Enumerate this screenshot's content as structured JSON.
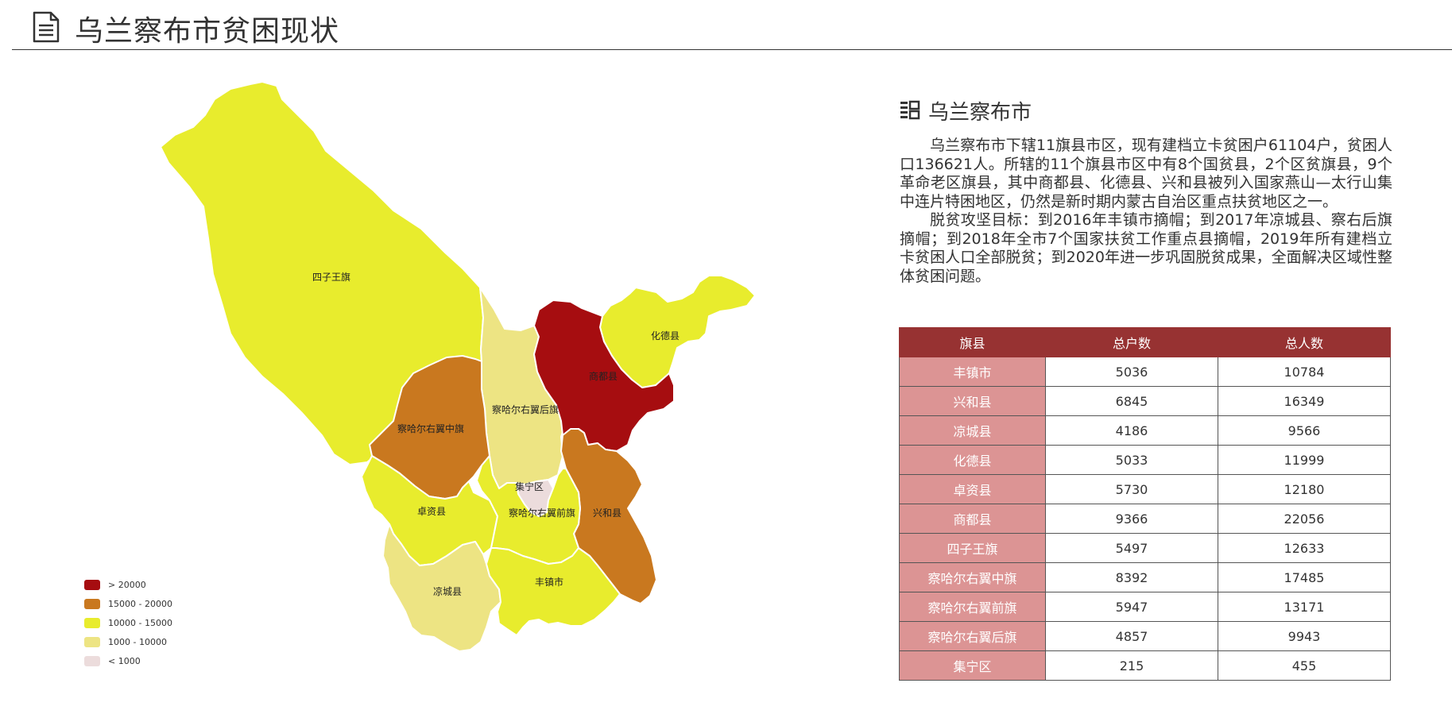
{
  "header": {
    "title": "乌兰察布市贫困现状",
    "icon": "document-icon"
  },
  "map": {
    "regions": [
      {
        "name": "四子王旗",
        "value": 12633,
        "color": "#e8ec2d"
      },
      {
        "name": "化德县",
        "value": 11999,
        "color": "#e8ec2d"
      },
      {
        "name": "商都县",
        "value": 22056,
        "color": "#a60d10"
      },
      {
        "name": "察哈尔右翼后旗",
        "value": 9943,
        "color": "#ede483"
      },
      {
        "name": "察哈尔右翼中旗",
        "value": 17485,
        "color": "#c9781f"
      },
      {
        "name": "集宁区",
        "value": 455,
        "color": "#ecdcdc"
      },
      {
        "name": "卓资县",
        "value": 12180,
        "color": "#e8ec2d"
      },
      {
        "name": "察哈尔右翼前旗",
        "value": 13171,
        "color": "#e8ec2d"
      },
      {
        "name": "兴和县",
        "value": 16349,
        "color": "#c9781f"
      },
      {
        "name": "凉城县",
        "value": 9566,
        "color": "#ede483"
      },
      {
        "name": "丰镇市",
        "value": 10784,
        "color": "#e8ec2d"
      }
    ],
    "legend": [
      {
        "label": "> 20000",
        "color": "#a60d10"
      },
      {
        "label": "15000 - 20000",
        "color": "#c9781f"
      },
      {
        "label": "10000 - 15000",
        "color": "#e8ec2d"
      },
      {
        "label": "1000 - 10000",
        "color": "#ede483"
      },
      {
        "label": "< 1000",
        "color": "#ecdcdc"
      }
    ]
  },
  "info": {
    "icon": "list-icon",
    "subtitle": "乌兰察布市",
    "paragraphs": [
      "乌兰察布市下辖11旗县市区，现有建档立卡贫困户61104户，贫困人口136621人。所辖的11个旗县市区中有8个国贫县，2个区贫旗县，9个革命老区旗县，其中商都县、化德县、兴和县被列入国家燕山—太行山集中连片特困地区，仍然是新时期内蒙古自治区重点扶贫地区之一。",
      "脱贫攻坚目标：到2016年丰镇市摘帽；到2017年凉城县、察右后旗摘帽；到2018年全市7个国家扶贫工作重点县摘帽，2019年所有建档立卡贫困人口全部脱贫；到2020年进一步巩固脱贫成果，全面解决区域性整体贫困问题。"
    ]
  },
  "table": {
    "headers": [
      "旗县",
      "总户数",
      "总人数"
    ],
    "rows": [
      [
        "丰镇市",
        "5036",
        "10784"
      ],
      [
        "兴和县",
        "6845",
        "16349"
      ],
      [
        "凉城县",
        "4186",
        "9566"
      ],
      [
        "化德县",
        "5033",
        "11999"
      ],
      [
        "卓资县",
        "5730",
        "12180"
      ],
      [
        "商都县",
        "9366",
        "22056"
      ],
      [
        "四子王旗",
        "5497",
        "12633"
      ],
      [
        "察哈尔右翼中旗",
        "8392",
        "17485"
      ],
      [
        "察哈尔右翼前旗",
        "5947",
        "13171"
      ],
      [
        "察哈尔右翼后旗",
        "4857",
        "9943"
      ],
      [
        "集宁区",
        "215",
        "455"
      ]
    ]
  },
  "colors": {
    "table_header_bg": "#973232",
    "table_name_bg": "#dc9494"
  }
}
